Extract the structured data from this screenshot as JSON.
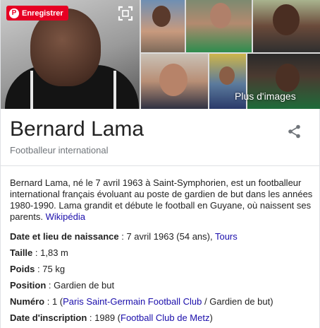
{
  "gallery": {
    "pin_label": "Enregistrer",
    "pin_icon": "pinterest-icon",
    "expand_icon": "expand-icon",
    "more_images": "Plus d'images"
  },
  "header": {
    "title": "Bernard Lama",
    "subtitle": "Footballeur international",
    "share_icon": "share-icon"
  },
  "description": {
    "text": "Bernard Lama, né le 7 avril 1963 à Saint-Symphorien, est un footballeur international français évoluant au poste de gardien de but dans les années 1980-1990. Lama grandit et débute le football en Guyane, où naissent ses parents. ",
    "source": "Wikipédia"
  },
  "facts": [
    {
      "label": "Date et lieu de naissance",
      "sep": " : ",
      "value": "7 avril 1963 (54 ans), ",
      "link": "Tours",
      "tail": ""
    },
    {
      "label": "Taille",
      "sep": " : ",
      "value": "1,83 m",
      "link": "",
      "tail": ""
    },
    {
      "label": "Poids",
      "sep": " : ",
      "value": "75 kg",
      "link": "",
      "tail": ""
    },
    {
      "label": "Position",
      "sep": " : ",
      "value": "Gardien de but",
      "link": "",
      "tail": ""
    },
    {
      "label": "Numéro",
      "sep": " : ",
      "value": "1 (",
      "link": "Paris Saint-Germain Football Club",
      "tail": " / Gardien de but)"
    },
    {
      "label": "Date d'inscription",
      "sep": " : ",
      "value": "1989 (",
      "link": "Football Club de Metz",
      "tail": ")"
    }
  ],
  "colors": {
    "link": "#1a0dab",
    "pinterest": "#e60023",
    "muted": "#70757a"
  }
}
